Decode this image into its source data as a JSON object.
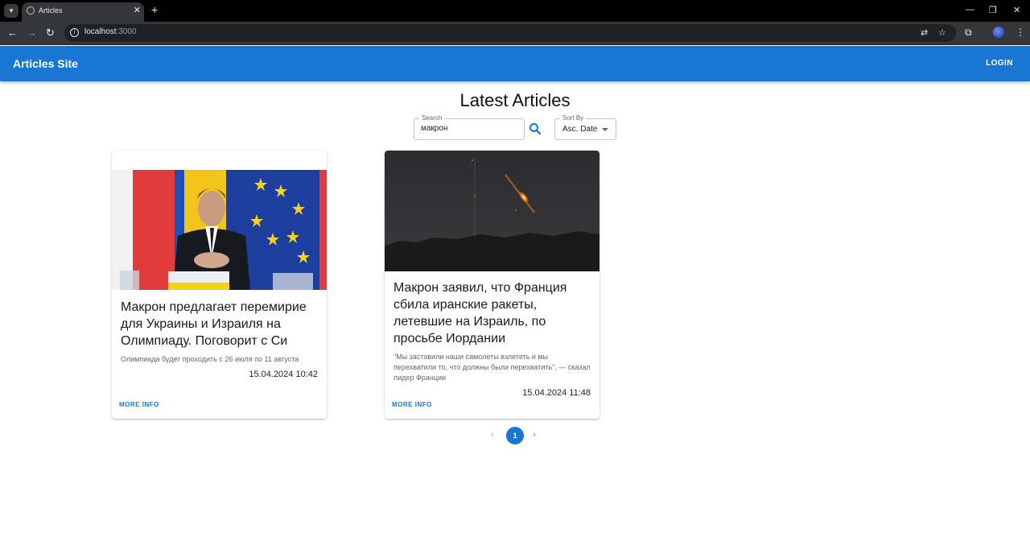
{
  "browser": {
    "tab_title": "Articles",
    "url_host": "localhost",
    "url_port": ":3000"
  },
  "app": {
    "site_title": "Articles Site",
    "login_label": "LOGIN",
    "accent_color": "#1976d2"
  },
  "main": {
    "title": "Latest Articles",
    "search": {
      "label": "Search",
      "value": "макрон"
    },
    "sort": {
      "label": "Sort By",
      "value": "Asc. Date"
    }
  },
  "articles": [
    {
      "title": "Макрон предлагает перемирие для Украины и Израиля на Олимпиаду. Поговорит с Си",
      "description": "Олимпиада будет проходить с 26 июля по 11 августа",
      "date": "15.04.2024 10:42",
      "more_label": "MORE INFO",
      "image": "photo-politician-speaking-with-flags"
    },
    {
      "title": "Макрон заявил, что Франция сбила иранские ракеты, летевшие на Израиль, по просьбе Иордании",
      "description": "\"Мы заставили наши самолеты взлететь и мы перехватили то, что должны были перехватить\", — сказал лидер Франции",
      "date": "15.04.2024 11:48",
      "more_label": "MORE INFO",
      "image": "photo-night-sky-missile"
    }
  ],
  "pagination": {
    "current_page": "1"
  }
}
